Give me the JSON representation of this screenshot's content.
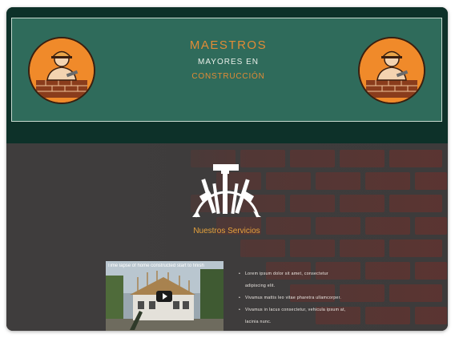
{
  "header": {
    "brand_line1": "MAESTROS",
    "brand_line2": "MAYORES EN",
    "brand_line3": "CONSTRUCCIÓN",
    "logo_left_icon": "builder-logo-icon",
    "logo_right_icon": "builder-logo-icon"
  },
  "services": {
    "icon": "tools-emblem-icon",
    "title": "Nuestros Servicios"
  },
  "video": {
    "title": "Time lapse of home constructed start to finish"
  },
  "list": {
    "items": [
      "Lorem ipsum dolor sit amet, consectetur",
      "adipiscing elit.",
      "Vivamus mattis leo vitae pharetra ullamcorper.",
      "Vivamus in lacus consectetur, vehicula ipsum at,",
      "lacinia nunc."
    ]
  },
  "colors": {
    "banner": "#2f6b5b",
    "header_bg": "#0d3129",
    "accent": "#e18b36"
  }
}
